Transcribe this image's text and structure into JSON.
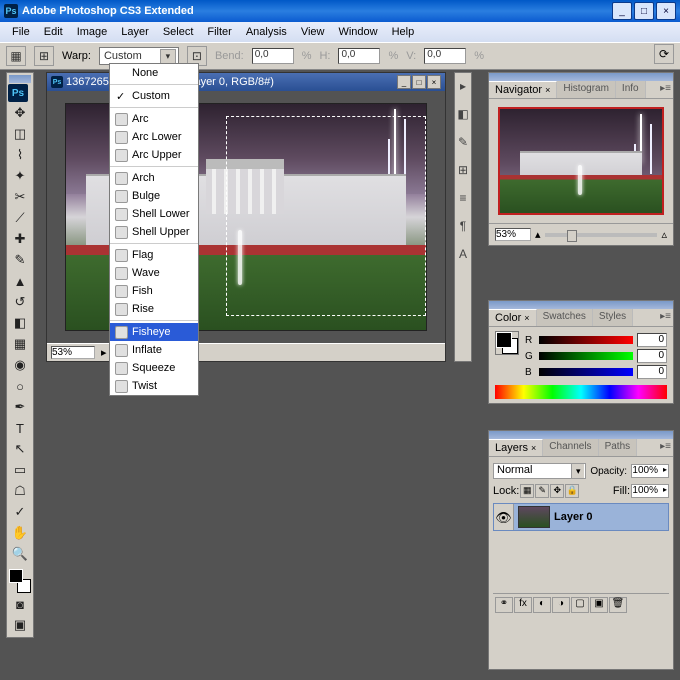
{
  "app": {
    "title": "Adobe Photoshop CS3 Extended"
  },
  "menus": [
    "File",
    "Edit",
    "Image",
    "Layer",
    "Select",
    "Filter",
    "Analysis",
    "View",
    "Window",
    "Help"
  ],
  "options": {
    "warp_label": "Warp:",
    "warp_value": "Custom",
    "bend_label": "Bend:",
    "bend_val": "0,0",
    "h_label": "H:",
    "h_val": "0,0",
    "v_label": "V:",
    "v_val": "0,0",
    "pct": "%"
  },
  "warp_menu": {
    "none": "None",
    "custom": "Custom",
    "g1": [
      "Arc",
      "Arc Lower",
      "Arc Upper"
    ],
    "g2": [
      "Arch",
      "Bulge",
      "Shell Lower",
      "Shell Upper"
    ],
    "g3": [
      "Flag",
      "Wave",
      "Fish",
      "Rise"
    ],
    "g4": [
      "Fisheye",
      "Inflate",
      "Squeeze",
      "Twist"
    ]
  },
  "doc": {
    "title_prefix": "1367265",
    "title_suffix": "% (Layer 0, RGB/8#)",
    "zoom": "53%",
    "status": ""
  },
  "nav": {
    "tabs": [
      "Navigator",
      "Histogram",
      "Info"
    ],
    "zoom": "53%"
  },
  "color": {
    "tabs": [
      "Color",
      "Swatches",
      "Styles"
    ],
    "r": "R",
    "g": "G",
    "b": "B",
    "rv": "0",
    "gv": "0",
    "bv": "0"
  },
  "layers": {
    "tabs": [
      "Layers",
      "Channels",
      "Paths"
    ],
    "mode": "Normal",
    "opacity_lbl": "Opacity:",
    "opacity": "100%",
    "lock_lbl": "Lock:",
    "fill_lbl": "Fill:",
    "fill": "100%",
    "layer0": "Layer 0"
  }
}
